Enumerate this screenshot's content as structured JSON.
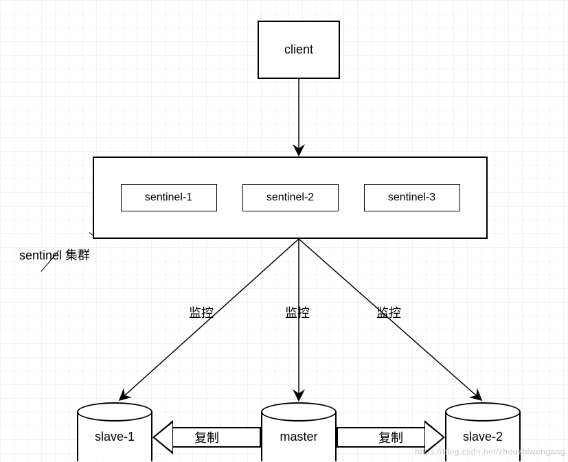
{
  "nodes": {
    "client": "client",
    "cluster_label": "sentinel 集群",
    "sentinels": [
      "sentinel-1",
      "sentinel-2",
      "sentinel-3"
    ],
    "master": "master",
    "slave1": "slave-1",
    "slave2": "slave-2"
  },
  "edges": {
    "monitor": "监控",
    "replicate": "复制"
  },
  "watermark": "https://blog.csdn.net/zhouzhiwengang"
}
